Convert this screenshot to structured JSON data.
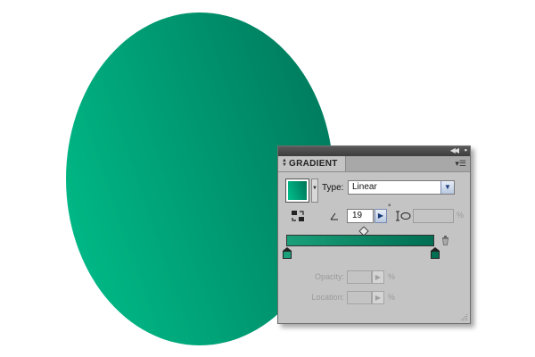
{
  "artwork": {
    "gradient_start": "#00c08a",
    "gradient_end": "#00755a"
  },
  "panel": {
    "title": "GRADIENT",
    "icons": {
      "collapse": "double-chevron-icon",
      "close": "close-icon",
      "menu": "panel-menu-icon",
      "tab_arrows": "tab-arrows-icon",
      "reverse": "reverse-gradient-icon",
      "angle": "angle-icon",
      "aspect": "aspect-ratio-icon",
      "delete": "trash-icon"
    },
    "type_label": "Type:",
    "type_value": "Linear",
    "angle_value": "19",
    "degree": "°",
    "aspect_unit": "%",
    "opacity_label": "Opacity:",
    "opacity_unit": "%",
    "location_label": "Location:",
    "location_unit": "%",
    "colors": {
      "stop_left": "#1aa07a",
      "stop_right": "#006e52"
    }
  }
}
